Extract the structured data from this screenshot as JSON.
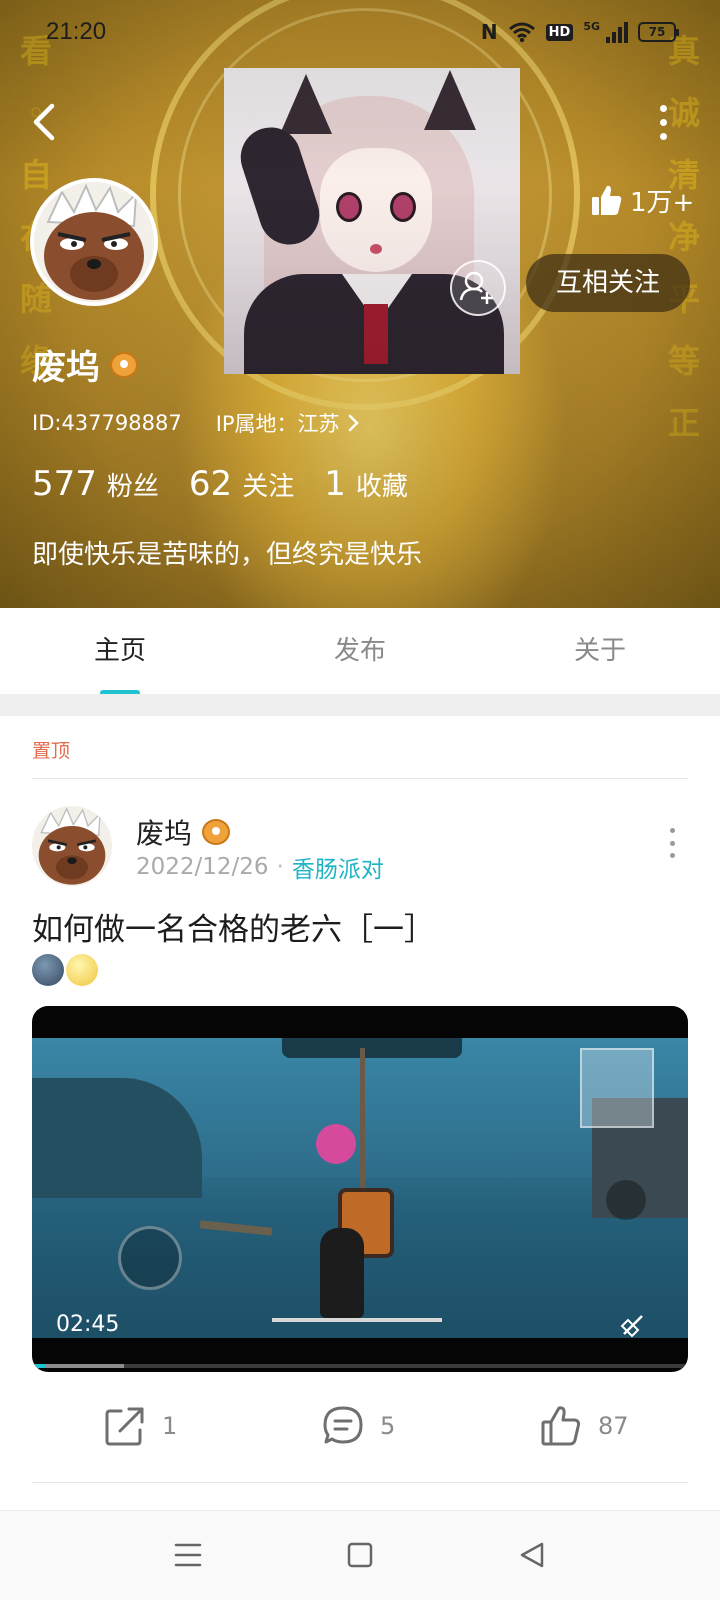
{
  "status_bar": {
    "time": "21:20",
    "network": "5G",
    "hd": "HD",
    "battery": "75"
  },
  "profile": {
    "name": "废坞",
    "id": "ID:437798887",
    "ip_location": "IP属地：江苏",
    "likes": "1万+",
    "follow_status": "互相关注",
    "bio": "即使快乐是苦味的，但终究是快乐",
    "stats": {
      "fans_count": "577",
      "fans_label": "粉丝",
      "following_count": "62",
      "following_label": "关注",
      "favorites_count": "1",
      "favorites_label": "收藏"
    }
  },
  "tabs": [
    {
      "label": "主页",
      "active": true
    },
    {
      "label": "发布",
      "active": false
    },
    {
      "label": "关于",
      "active": false
    }
  ],
  "pinned_label": "置顶",
  "post": {
    "author": "废坞",
    "date": "2022/12/26",
    "separator": "·",
    "topic": "香肠派对",
    "title": "如何做一名合格的老六［一］",
    "emojis": [
      "new-moon-face",
      "full-moon-face"
    ],
    "video": {
      "duration": "02:45",
      "progress": 0.02,
      "buffered": 0.14
    },
    "actions": {
      "share_count": "1",
      "comment_count": "5",
      "like_count": "87"
    }
  },
  "colors": {
    "accent": "#1fc2cf",
    "pinned": "#e66a4e",
    "topic": "#1fb4c3",
    "muted": "#8a8a8a"
  },
  "icons": [
    "back-arrow-icon",
    "more-vertical-icon",
    "thumbs-up-icon",
    "add-friend-icon",
    "share-icon",
    "comment-icon",
    "like-icon",
    "menu-icon",
    "home-square-icon",
    "back-triangle-icon"
  ]
}
